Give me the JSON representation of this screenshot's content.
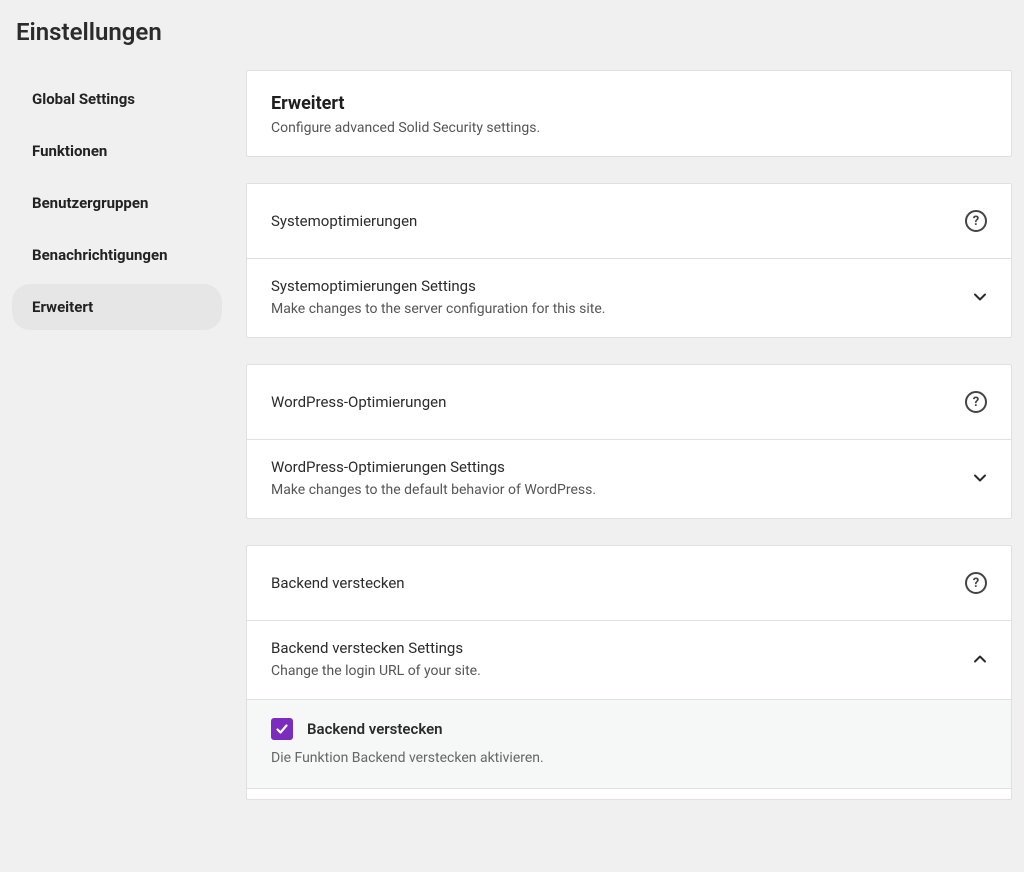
{
  "page_title": "Einstellungen",
  "sidebar": {
    "items": [
      {
        "label": "Global Settings",
        "active": false
      },
      {
        "label": "Funktionen",
        "active": false
      },
      {
        "label": "Benutzergruppen",
        "active": false
      },
      {
        "label": "Benachrichtigungen",
        "active": false
      },
      {
        "label": "Erweitert",
        "active": true
      }
    ]
  },
  "intro": {
    "title": "Erweitert",
    "desc": "Configure advanced Solid Security settings."
  },
  "modules": [
    {
      "header": "Systemoptimierungen",
      "settings_title": "Systemoptimierungen Settings",
      "settings_desc": "Make changes to the server configuration for this site.",
      "expanded": false
    },
    {
      "header": "WordPress-Optimierungen",
      "settings_title": "WordPress-Optimierungen Settings",
      "settings_desc": "Make changes to the default behavior of WordPress.",
      "expanded": false
    },
    {
      "header": "Backend verstecken",
      "settings_title": "Backend verstecken Settings",
      "settings_desc": "Change the login URL of your site.",
      "expanded": true,
      "option": {
        "label": "Backend verstecken",
        "desc": "Die Funktion Backend verstecken aktivieren.",
        "checked": true
      }
    }
  ]
}
